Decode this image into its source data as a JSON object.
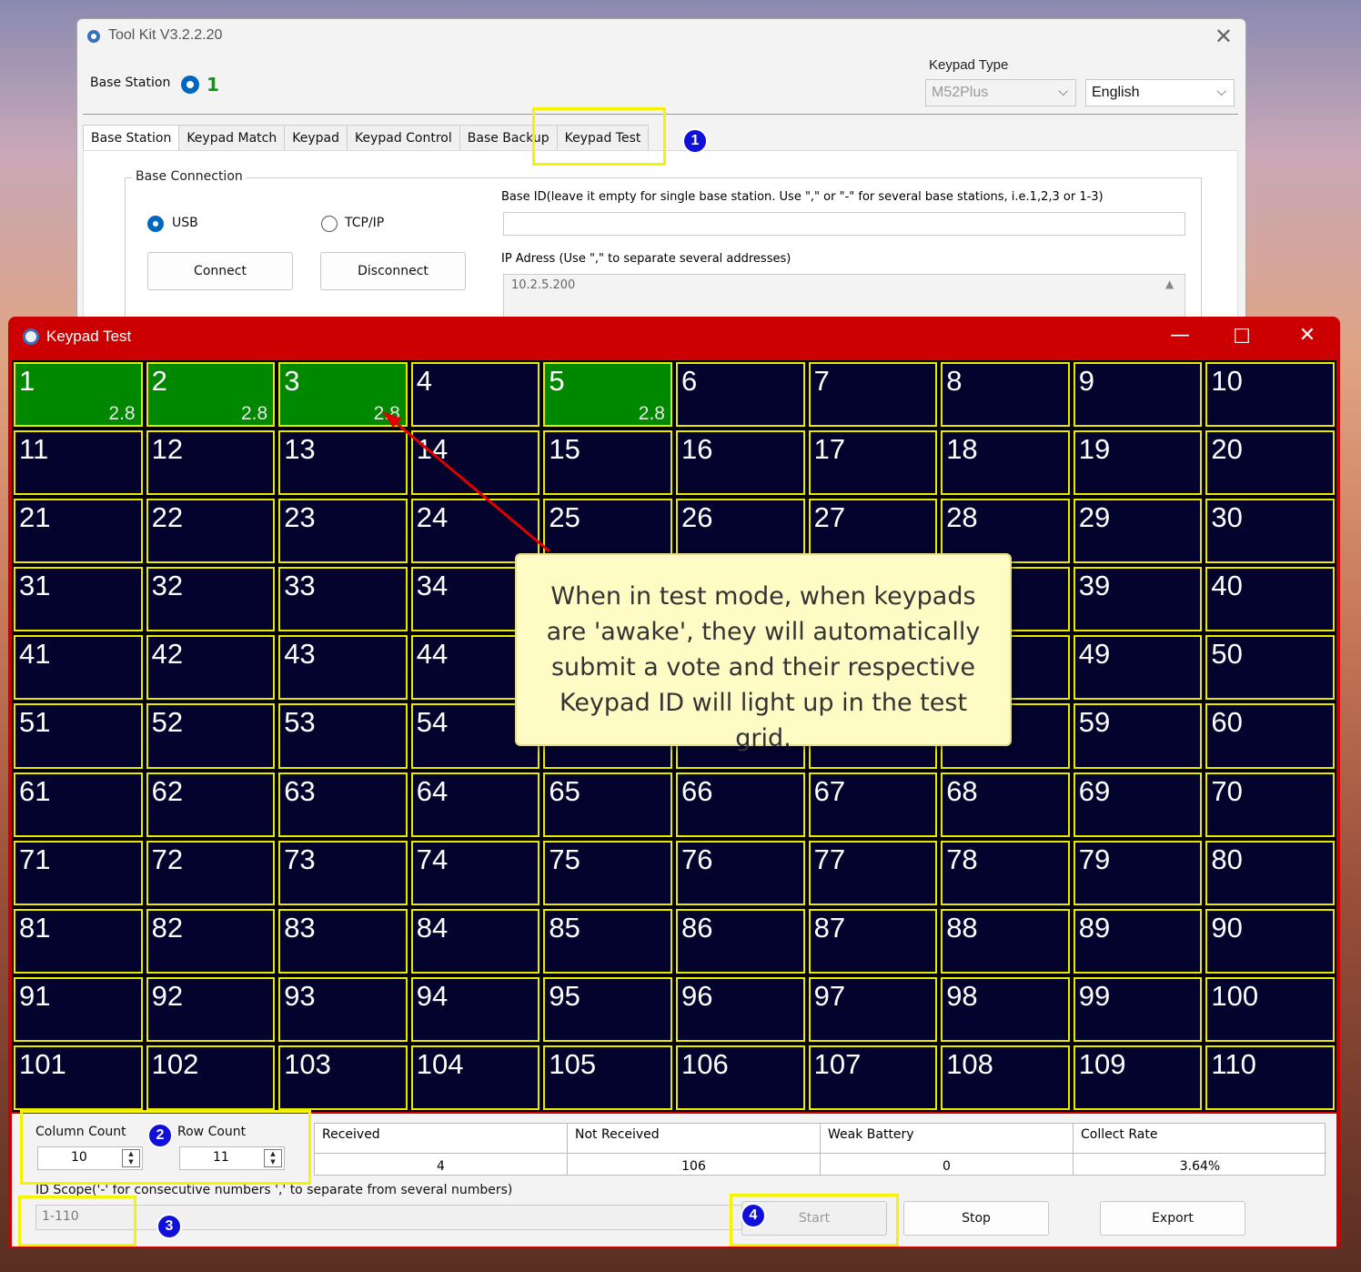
{
  "toolkit": {
    "title": "Tool Kit  V3.2.2.20",
    "base_station_label": "Base Station",
    "base_station_value": "1",
    "keypad_type_label": "Keypad Type",
    "keypad_type_value": "M52Plus",
    "language_value": "English",
    "tabs": [
      "Base Station",
      "Keypad Match",
      "Keypad",
      "Keypad Control",
      "Base Backup",
      "Keypad Test"
    ],
    "base_connection_legend": "Base Connection",
    "usb_label": "USB",
    "tcp_label": "TCP/IP",
    "connect_label": "Connect",
    "disconnect_label": "Disconnect",
    "base_id_label": "Base ID(leave it empty for single base station. Use \",\" or \"-\" for several base stations, i.e.1,2,3 or 1-3)",
    "base_id_value": "",
    "ip_label": "IP Adress (Use \",\" to separate several addresses)",
    "ip_value": "10.2.5.200"
  },
  "keypad_test": {
    "title": "Keypad Test",
    "grid": {
      "columns": 10,
      "rows": 11,
      "active_cells": [
        {
          "id": 1,
          "value": "2.8"
        },
        {
          "id": 2,
          "value": "2.8"
        },
        {
          "id": 3,
          "value": "2.8"
        },
        {
          "id": 5,
          "value": "2.8"
        }
      ],
      "total": 110
    },
    "column_count_label": "Column Count",
    "column_count_value": "10",
    "row_count_label": "Row Count",
    "row_count_value": "11",
    "stats": [
      {
        "label": "Received",
        "value": "4"
      },
      {
        "label": "Not Received",
        "value": "106"
      },
      {
        "label": "Weak Battery",
        "value": "0"
      },
      {
        "label": "Collect Rate",
        "value": "3.64%"
      }
    ],
    "id_scope_label": "ID Scope('-' for consecutive numbers ',' to separate from several numbers)",
    "id_scope_value": "1-110",
    "start_label": "Start",
    "stop_label": "Stop",
    "export_label": "Export"
  },
  "annotations": {
    "badges": [
      "1",
      "2",
      "3",
      "4"
    ],
    "callout_text": "When in test mode, when keypads are 'awake', they will automatically submit a vote and their respective Keypad ID will light up in the test grid.",
    "highlight_color": "#f4f400",
    "badge_color": "#1010d8",
    "arrow_color": "#e00000"
  },
  "colors": {
    "window_accent": "#cc0000",
    "cell_active": "#008800",
    "cell_idle": "#03032e",
    "cell_border": "#e8e800"
  }
}
